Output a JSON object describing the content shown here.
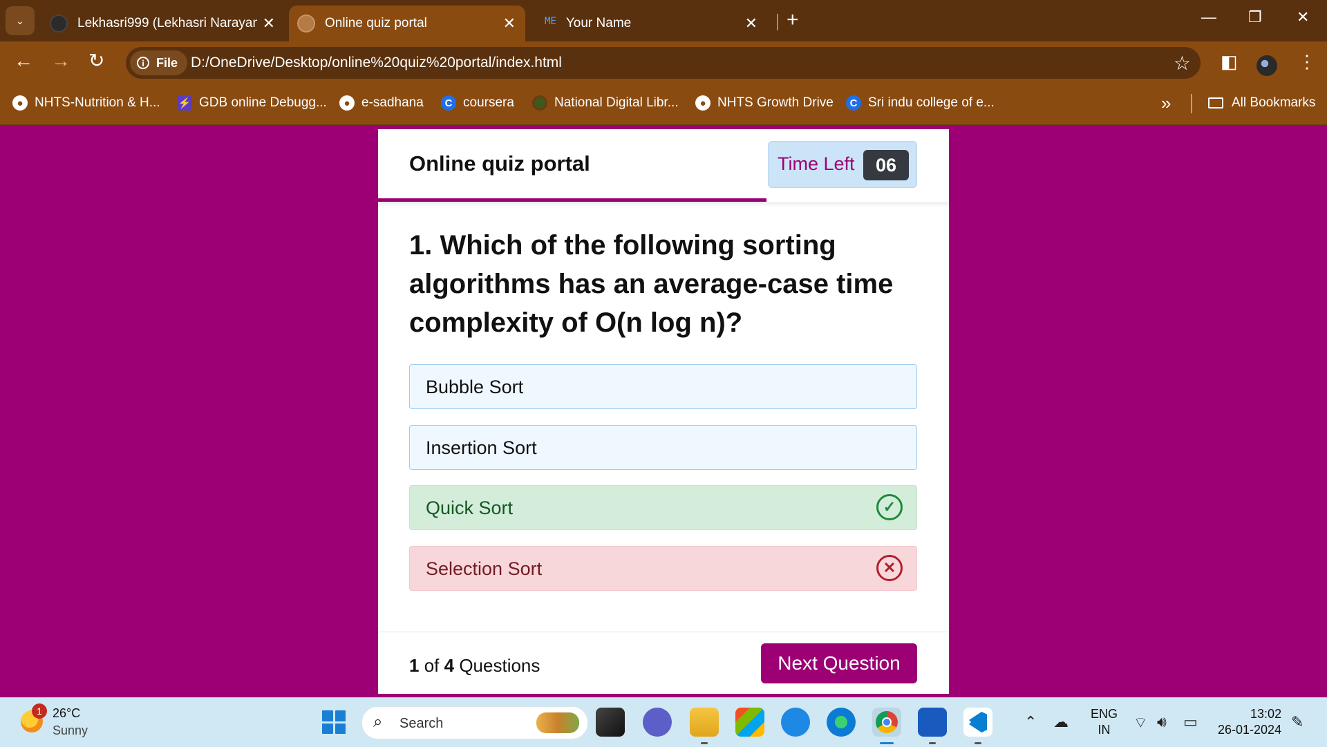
{
  "browser": {
    "tabs": [
      {
        "title": "Lekhasri999 (Lekhasri Narayana"
      },
      {
        "title": "Online quiz portal"
      },
      {
        "title": "Your Name",
        "favicon_text": "ME"
      }
    ],
    "address": {
      "scheme_label": "File",
      "url": "D:/OneDrive/Desktop/online%20quiz%20portal/index.html"
    },
    "bookmarks": [
      {
        "label": "NHTS-Nutrition & H..."
      },
      {
        "label": "GDB online Debugg..."
      },
      {
        "label": "e-sadhana"
      },
      {
        "label": "coursera"
      },
      {
        "label": "National Digital Libr..."
      },
      {
        "label": "NHTS Growth Drive"
      },
      {
        "label": "Sri indu college of e..."
      }
    ],
    "all_bookmarks_label": "All Bookmarks"
  },
  "quiz": {
    "title": "Online quiz portal",
    "time_label": "Time Left",
    "time_seconds": "06",
    "question": "1. Which of the following sorting algorithms has an average-case time complexity of O(n log n)?",
    "options": [
      {
        "text": "Bubble Sort",
        "state": "neutral"
      },
      {
        "text": "Insertion Sort",
        "state": "neutral"
      },
      {
        "text": "Quick Sort",
        "state": "correct"
      },
      {
        "text": "Selection Sort",
        "state": "wrong"
      }
    ],
    "counter": {
      "current": "1",
      "of": "of",
      "total": "4",
      "suffix": "Questions"
    },
    "next_button": "Next Question",
    "accent_color": "#9c0074"
  },
  "taskbar": {
    "weather": {
      "temp": "26°C",
      "desc": "Sunny",
      "badge": "1"
    },
    "search_placeholder": "Search",
    "language": {
      "line1": "ENG",
      "line2": "IN"
    },
    "clock": {
      "time": "13:02",
      "date": "26-01-2024"
    }
  }
}
